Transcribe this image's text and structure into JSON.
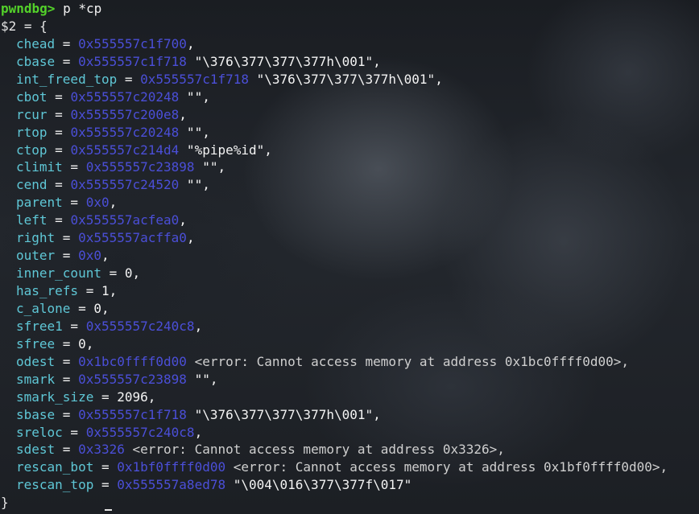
{
  "prompt": {
    "label": "pwndbg>",
    "command": " p *cp"
  },
  "result": {
    "header": "$2 = {",
    "footer": "}"
  },
  "fields": [
    {
      "name": "chead",
      "kind": "addr",
      "value": "0x555557c1f700",
      "rest": ","
    },
    {
      "name": "cbase",
      "kind": "addr",
      "value": "0x555557c1f718",
      "rest": " \"\\376\\377\\377\\377h\\001\","
    },
    {
      "name": "int_freed_top",
      "kind": "addr",
      "value": "0x555557c1f718",
      "rest": " \"\\376\\377\\377\\377h\\001\","
    },
    {
      "name": "cbot",
      "kind": "addr",
      "value": "0x555557c20248",
      "rest": " \"\","
    },
    {
      "name": "rcur",
      "kind": "addr",
      "value": "0x555557c200e8",
      "rest": ","
    },
    {
      "name": "rtop",
      "kind": "addr",
      "value": "0x555557c20248",
      "rest": " \"\","
    },
    {
      "name": "ctop",
      "kind": "addr",
      "value": "0x555557c214d4",
      "rest": " \"%pipe%id\","
    },
    {
      "name": "climit",
      "kind": "addr",
      "value": "0x555557c23898",
      "rest": " \"\","
    },
    {
      "name": "cend",
      "kind": "addr",
      "value": "0x555557c24520",
      "rest": " \"\","
    },
    {
      "name": "parent",
      "kind": "addr",
      "value": "0x0",
      "rest": ","
    },
    {
      "name": "left",
      "kind": "addr",
      "value": "0x555557acfea0",
      "rest": ","
    },
    {
      "name": "right",
      "kind": "addr",
      "value": "0x555557acffa0",
      "rest": ","
    },
    {
      "name": "outer",
      "kind": "addr",
      "value": "0x0",
      "rest": ","
    },
    {
      "name": "inner_count",
      "kind": "num",
      "value": "0",
      "rest": ","
    },
    {
      "name": "has_refs",
      "kind": "num",
      "value": "1",
      "rest": ","
    },
    {
      "name": "c_alone",
      "kind": "num",
      "value": "0",
      "rest": ","
    },
    {
      "name": "sfree1",
      "kind": "addr",
      "value": "0x555557c240c8",
      "rest": ","
    },
    {
      "name": "sfree",
      "kind": "num",
      "value": "0",
      "rest": ","
    },
    {
      "name": "odest",
      "kind": "addr",
      "value": "0x1bc0ffff0d00",
      "rest": " <error: Cannot access memory at address 0x1bc0ffff0d00>,"
    },
    {
      "name": "smark",
      "kind": "addr",
      "value": "0x555557c23898",
      "rest": " \"\","
    },
    {
      "name": "smark_size",
      "kind": "num",
      "value": "2096",
      "rest": ","
    },
    {
      "name": "sbase",
      "kind": "addr",
      "value": "0x555557c1f718",
      "rest": " \"\\376\\377\\377\\377h\\001\","
    },
    {
      "name": "sreloc",
      "kind": "addr",
      "value": "0x555557c240c8",
      "rest": ","
    },
    {
      "name": "sdest",
      "kind": "addr",
      "value": "0x3326",
      "rest": " <error: Cannot access memory at address 0x3326>,"
    },
    {
      "name": "rescan_bot",
      "kind": "addr",
      "value": "0x1bf0ffff0d00",
      "rest": " <error: Cannot access memory at address 0x1bf0ffff0d00>,"
    },
    {
      "name": "rescan_top",
      "kind": "addr",
      "value": "0x555557a8ed78",
      "rest": " \"\\004\\016\\377\\377f\\017\""
    }
  ],
  "theme": {
    "prompt_color": "#53d12a",
    "field_color": "#5fc7d6",
    "address_color": "#4b4fd8",
    "text_color": "#f4f4f4"
  }
}
